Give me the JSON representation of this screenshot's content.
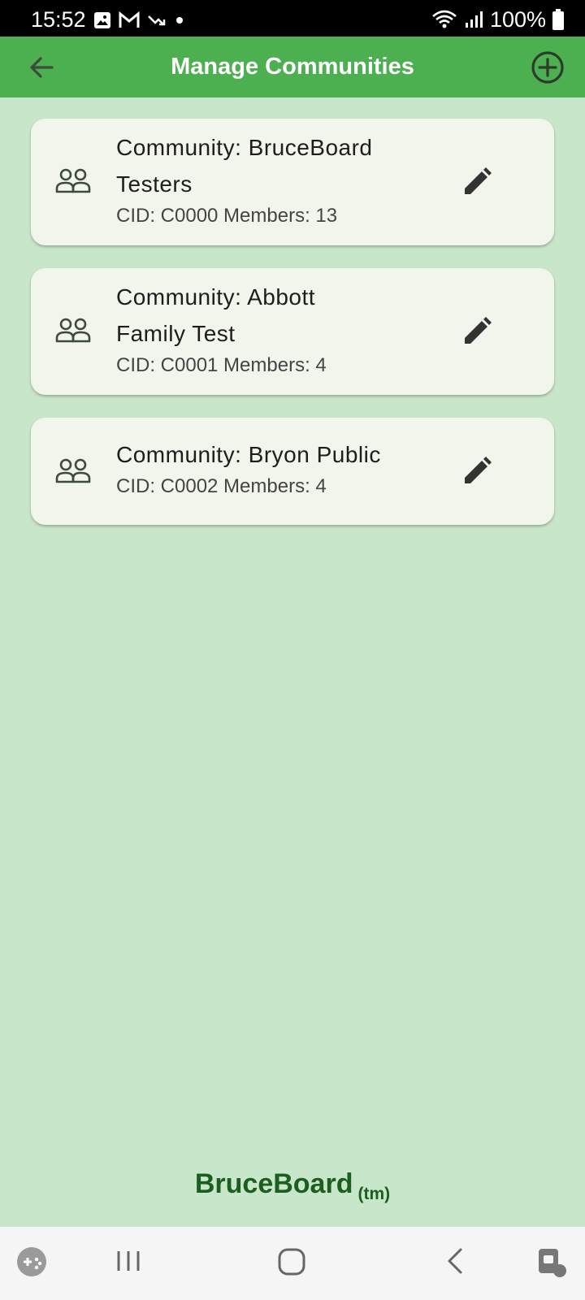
{
  "status_bar": {
    "time": "15:52",
    "battery": "100%",
    "left_icons": [
      "image-icon",
      "gmail-icon",
      "missed-call-icon",
      "dot-icon"
    ],
    "right_icons": [
      "wifi-icon",
      "signal-icon",
      "battery-icon"
    ]
  },
  "app_bar": {
    "title": "Manage Communities",
    "back_icon": "arrow-back-icon",
    "add_icon": "add-circle-icon",
    "color": "#4caf50"
  },
  "communities": [
    {
      "title_line1": "Community: BruceBoard",
      "title_line2": "Testers",
      "subtitle": "CID: C0000 Members: 13"
    },
    {
      "title_line1": "Community: Abbott",
      "title_line2": "Family Test",
      "subtitle": "CID: C0001 Members: 4"
    },
    {
      "title_line1": "Community: Bryon Public",
      "subtitle": "CID: C0002 Members: 4"
    }
  ],
  "footer": {
    "brand": "BruceBoard",
    "trademark": "(tm)",
    "color": "#1b5e20"
  },
  "nav_bar": {
    "icons": [
      "game-launcher-icon",
      "recents-icon",
      "home-icon",
      "back-icon",
      "assistant-icon"
    ]
  },
  "colors": {
    "background": "#c8e6c9",
    "card": "#f1f5ec",
    "icon": "#3f4a3f"
  }
}
